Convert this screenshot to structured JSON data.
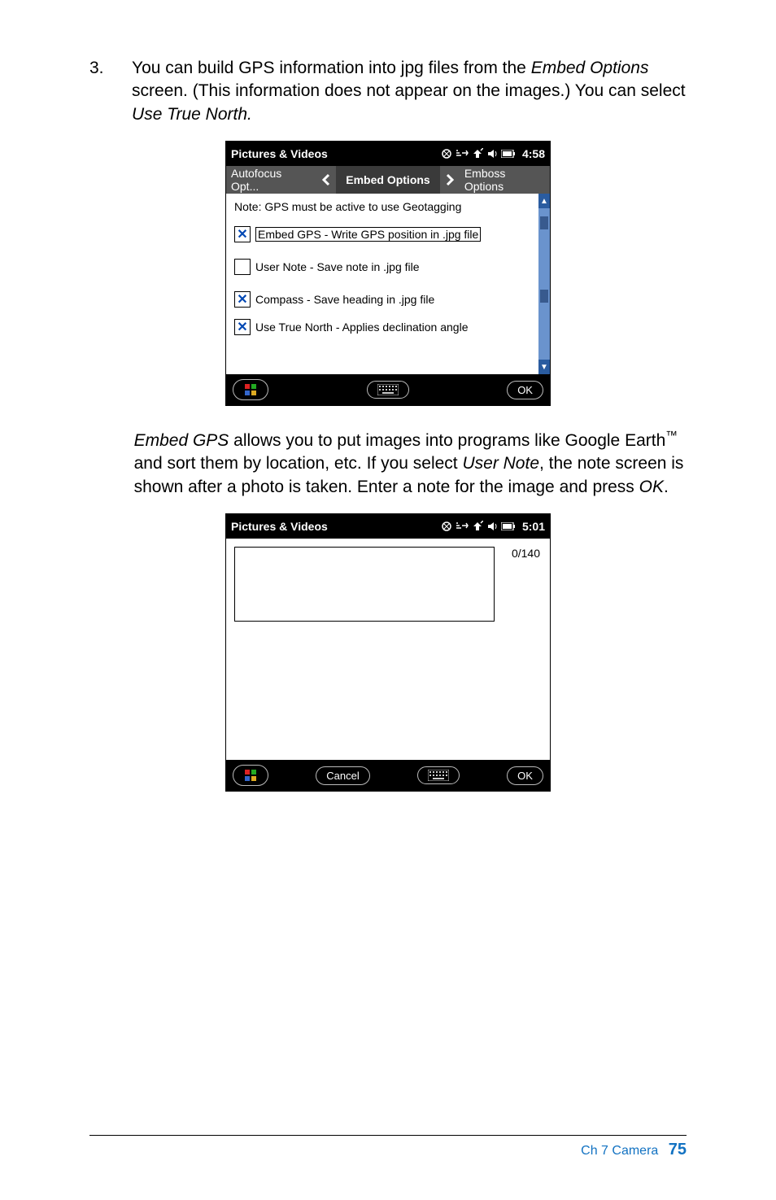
{
  "step": {
    "number": "3.",
    "text_parts": {
      "p1a": "You can build GPS information into jpg files from the ",
      "p1b": "Embed Options",
      "p1c": " screen. (This information does not appear on the images.) You can select ",
      "p1d": "Use True North."
    }
  },
  "screenshot1": {
    "title": "Pictures & Videos",
    "time": "4:58",
    "tabs": {
      "prev": "Autofocus Opt...",
      "current": "Embed Options",
      "next": "Emboss Options"
    },
    "note": "Note: GPS must be active to use Geotagging",
    "options": [
      {
        "checked": true,
        "label": "Embed GPS - Write GPS position in .jpg file",
        "boxed": true
      },
      {
        "checked": false,
        "label": "User Note - Save note in .jpg file",
        "boxed": false
      },
      {
        "checked": true,
        "label": "Compass - Save heading in .jpg file",
        "boxed": false
      },
      {
        "checked": true,
        "label": "Use True North - Applies declination angle",
        "boxed": false
      }
    ],
    "ok": "OK"
  },
  "mid_para": {
    "a": "Embed GPS",
    "b": " allows you to put images into programs like Google Earth",
    "c": " and sort them by location, etc. If you select ",
    "d": "User Note",
    "e": ", the note screen is shown after a photo is taken. Enter a note for the image and press ",
    "f": "OK",
    "g": "."
  },
  "screenshot2": {
    "title": "Pictures & Videos",
    "time": "5:01",
    "count": "0/140",
    "cancel": "Cancel",
    "ok": "OK"
  },
  "footer": {
    "chapter": "Ch 7   Camera",
    "page": "75"
  }
}
